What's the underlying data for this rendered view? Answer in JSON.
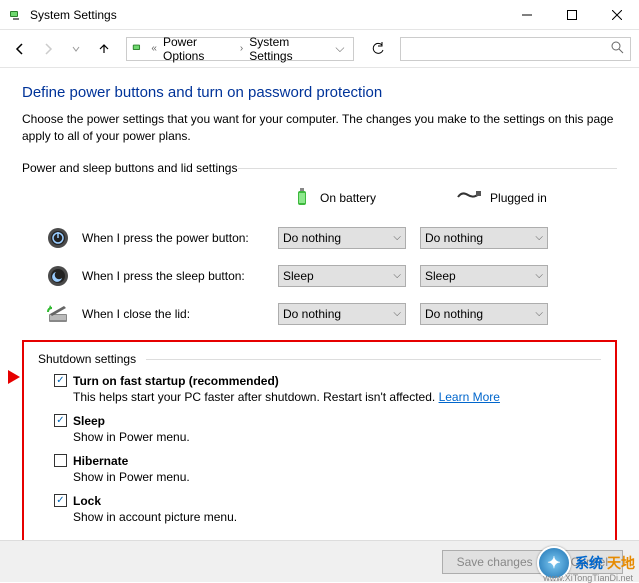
{
  "titlebar": {
    "title": "System Settings"
  },
  "breadcrumb": {
    "seg1": "Power Options",
    "seg2": "System Settings"
  },
  "heading": "Define power buttons and turn on password protection",
  "description": "Choose the power settings that you want for your computer. The changes you make to the settings on this page apply to all of your power plans.",
  "group1_label": "Power and sleep buttons and lid settings",
  "columns": {
    "battery": "On battery",
    "plugged": "Plugged in"
  },
  "rows": [
    {
      "label": "When I press the power button:",
      "battery": "Do nothing",
      "plugged": "Do nothing"
    },
    {
      "label": "When I press the sleep button:",
      "battery": "Sleep",
      "plugged": "Sleep"
    },
    {
      "label": "When I close the lid:",
      "battery": "Do nothing",
      "plugged": "Do nothing"
    }
  ],
  "group2_label": "Shutdown settings",
  "checks": [
    {
      "label": "Turn on fast startup (recommended)",
      "desc_pre": "This helps start your PC faster after shutdown. Restart isn't affected. ",
      "link": "Learn More",
      "checked": true
    },
    {
      "label": "Sleep",
      "desc": "Show in Power menu.",
      "checked": true
    },
    {
      "label": "Hibernate",
      "desc": "Show in Power menu.",
      "checked": false
    },
    {
      "label": "Lock",
      "desc": "Show in account picture menu.",
      "checked": true
    }
  ],
  "footer": {
    "save": "Save changes",
    "cancel": "Cancel"
  },
  "watermark": {
    "t1": "系统",
    "t2": "天地",
    "url": "www.XiTongTianDi.net"
  }
}
